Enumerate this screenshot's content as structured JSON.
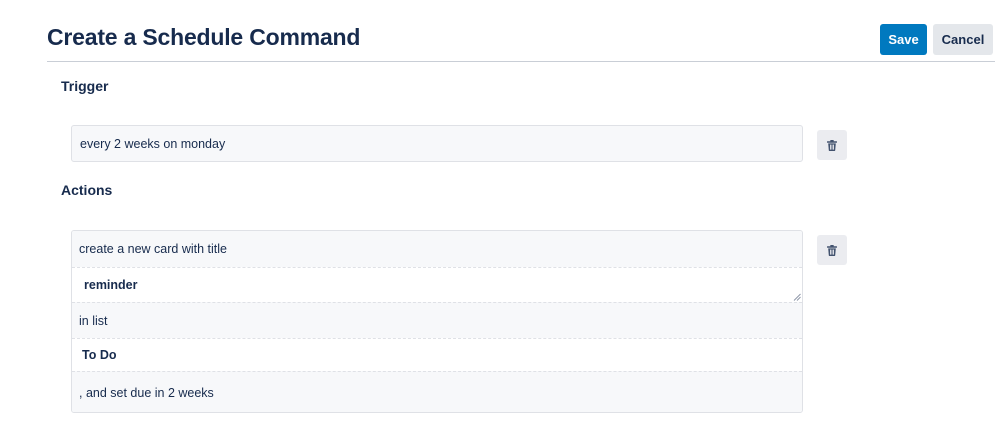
{
  "header": {
    "title": "Create a Schedule Command",
    "save_label": "Save",
    "cancel_label": "Cancel"
  },
  "trigger": {
    "heading": "Trigger",
    "value": "every 2 weeks on monday",
    "delete_icon": "trash-icon"
  },
  "actions": {
    "heading": "Actions",
    "delete_icon": "trash-icon",
    "parts": [
      "create a new card with title",
      "reminder",
      "in list",
      "To Do",
      ", and set due in 2 weeks"
    ]
  },
  "colors": {
    "primary": "#0079bf",
    "text": "#172b4d",
    "secondary_button": "#e4e7eb"
  }
}
